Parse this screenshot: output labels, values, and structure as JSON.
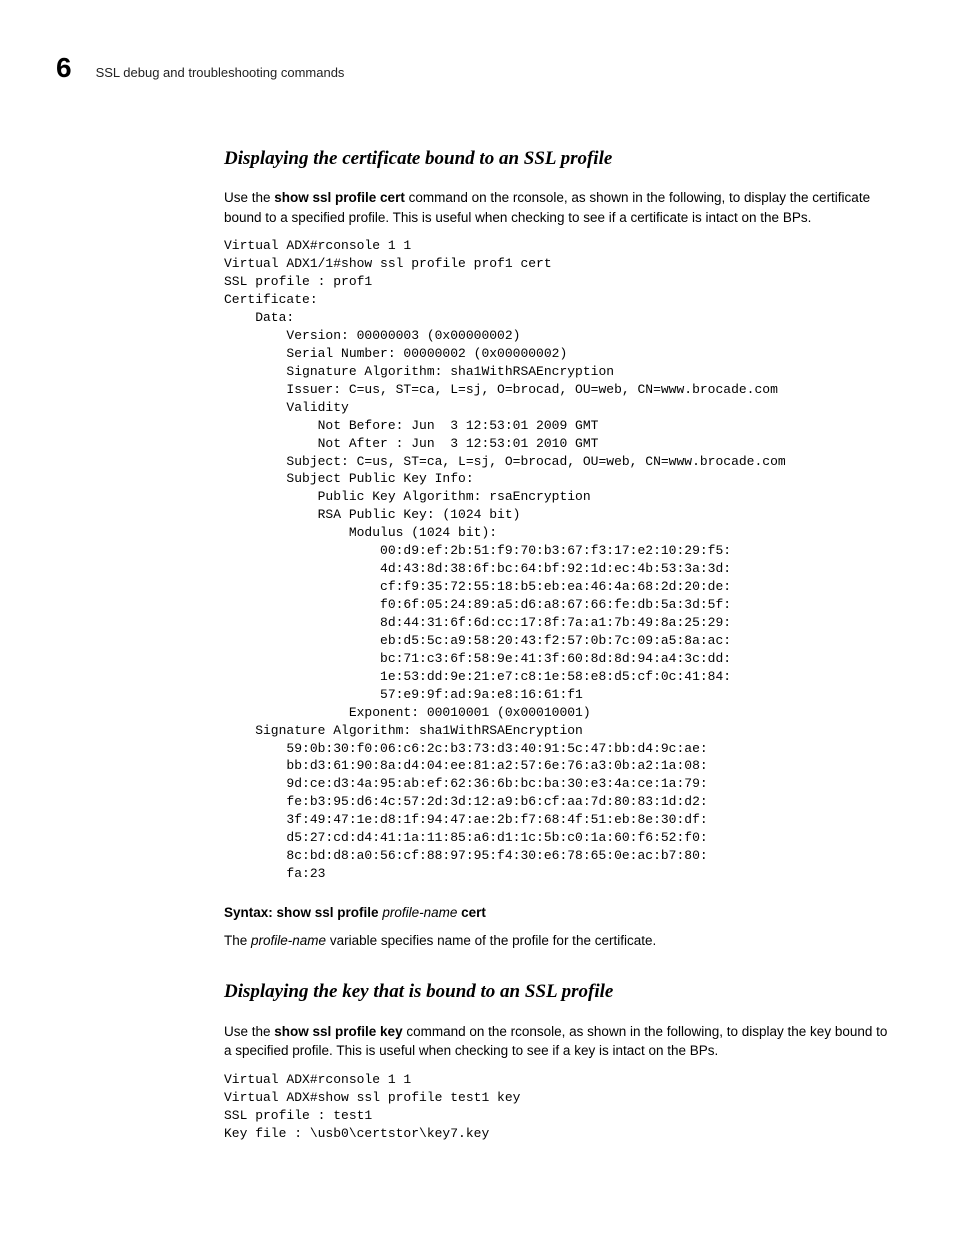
{
  "chapterNumber": "6",
  "runningTitle": "SSL debug and troubleshooting commands",
  "section1": {
    "heading": "Displaying the certificate bound to an SSL profile",
    "intro_prefix": "Use the ",
    "intro_bold": "show ssl profile cert",
    "intro_suffix": " command on the rconsole, as shown in the following, to display the certificate bound to a specified profile. This is useful when checking to see if a certificate is intact on the BPs.",
    "code": "Virtual ADX#rconsole 1 1\nVirtual ADX1/1#show ssl profile prof1 cert\nSSL profile : prof1\nCertificate:\n    Data:\n        Version: 00000003 (0x00000002)\n        Serial Number: 00000002 (0x00000002)\n        Signature Algorithm: sha1WithRSAEncryption\n        Issuer: C=us, ST=ca, L=sj, O=brocad, OU=web, CN=www.brocade.com\n        Validity\n            Not Before: Jun  3 12:53:01 2009 GMT\n            Not After : Jun  3 12:53:01 2010 GMT\n        Subject: C=us, ST=ca, L=sj, O=brocad, OU=web, CN=www.brocade.com\n        Subject Public Key Info:\n            Public Key Algorithm: rsaEncryption\n            RSA Public Key: (1024 bit)\n                Modulus (1024 bit):\n                    00:d9:ef:2b:51:f9:70:b3:67:f3:17:e2:10:29:f5:\n                    4d:43:8d:38:6f:bc:64:bf:92:1d:ec:4b:53:3a:3d:\n                    cf:f9:35:72:55:18:b5:eb:ea:46:4a:68:2d:20:de:\n                    f0:6f:05:24:89:a5:d6:a8:67:66:fe:db:5a:3d:5f:\n                    8d:44:31:6f:6d:cc:17:8f:7a:a1:7b:49:8a:25:29:\n                    eb:d5:5c:a9:58:20:43:f2:57:0b:7c:09:a5:8a:ac:\n                    bc:71:c3:6f:58:9e:41:3f:60:8d:8d:94:a4:3c:dd:\n                    1e:53:dd:9e:21:e7:c8:1e:58:e8:d5:cf:0c:41:84:\n                    57:e9:9f:ad:9a:e8:16:61:f1\n                Exponent: 00010001 (0x00010001)\n    Signature Algorithm: sha1WithRSAEncryption\n        59:0b:30:f0:06:c6:2c:b3:73:d3:40:91:5c:47:bb:d4:9c:ae:\n        bb:d3:61:90:8a:d4:04:ee:81:a2:57:6e:76:a3:0b:a2:1a:08:\n        9d:ce:d3:4a:95:ab:ef:62:36:6b:bc:ba:30:e3:4a:ce:1a:79:\n        fe:b3:95:d6:4c:57:2d:3d:12:a9:b6:cf:aa:7d:80:83:1d:d2:\n        3f:49:47:1e:d8:1f:94:47:ae:2b:f7:68:4f:51:eb:8e:30:df:\n        d5:27:cd:d4:41:1a:11:85:a6:d1:1c:5b:c0:1a:60:f6:52:f0:\n        8c:bd:d8:a0:56:cf:88:97:95:f4:30:e6:78:65:0e:ac:b7:80:\n        fa:23",
    "syntax_label": "Syntax:  ",
    "syntax_cmd1": "show ssl profile ",
    "syntax_var": "profile-name",
    "syntax_cmd2": " cert",
    "note_prefix": "The ",
    "note_var": "profile-name",
    "note_suffix": " variable specifies name of the profile for the certificate."
  },
  "section2": {
    "heading": "Displaying the key that is bound to an SSL profile",
    "intro_prefix": "Use the ",
    "intro_bold": "show ssl profile key",
    "intro_suffix": " command on the rconsole, as shown in the following, to display the key bound to a specified profile. This is useful when checking to see if a key is intact on the BPs.",
    "code": "Virtual ADX#rconsole 1 1\nVirtual ADX#show ssl profile test1 key\nSSL profile : test1\nKey file : \\usb0\\certstor\\key7.key"
  }
}
